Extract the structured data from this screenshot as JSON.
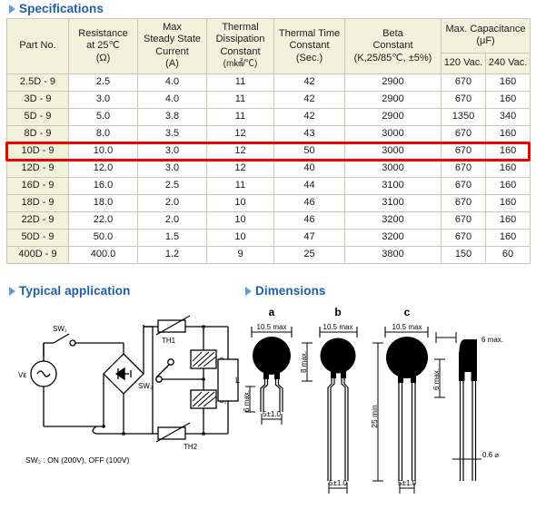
{
  "sections": {
    "specifications": {
      "title": "Specifications"
    },
    "typical_application": {
      "title": "Typical application"
    },
    "dimensions": {
      "title": "Dimensions"
    }
  },
  "spec_table": {
    "headers": {
      "part_no": "Part No.",
      "resistance": {
        "l1": "Resistance",
        "l2": "at 25℃",
        "l3": "(Ω)"
      },
      "max_current": {
        "l1": "Max",
        "l2": "Steady State",
        "l3": "Current",
        "l4": "(A)"
      },
      "dissipation": {
        "l1": "Thermal",
        "l2": "Dissipation",
        "l3": "Constant",
        "l4": "(m㎢/℃)"
      },
      "time_constant": {
        "l1": "Thermal Time",
        "l2": "Constant",
        "l3": "(Sec.)"
      },
      "beta": {
        "l1": "Beta",
        "l2": "Constant",
        "l3": "(K,25/85℃, ±5%)"
      },
      "capacitance": {
        "l1": "Max. Capacitance",
        "l2": "(μF)",
        "c120": "120 Vac.",
        "c240": "240 Vac."
      }
    },
    "rows": [
      {
        "part": "2.5D - 9",
        "res": "2.5",
        "cur": "4.0",
        "diss": "11",
        "ttc": "42",
        "beta": "2900",
        "c120": "670",
        "c240": "160"
      },
      {
        "part": "3D - 9",
        "res": "3.0",
        "cur": "4.0",
        "diss": "11",
        "ttc": "42",
        "beta": "2900",
        "c120": "670",
        "c240": "160"
      },
      {
        "part": "5D - 9",
        "res": "5.0",
        "cur": "3.8",
        "diss": "11",
        "ttc": "42",
        "beta": "2900",
        "c120": "1350",
        "c240": "340"
      },
      {
        "part": "8D - 9",
        "res": "8.0",
        "cur": "3.5",
        "diss": "12",
        "ttc": "43",
        "beta": "3000",
        "c120": "670",
        "c240": "160"
      },
      {
        "part": "10D - 9",
        "res": "10.0",
        "cur": "3.0",
        "diss": "12",
        "ttc": "50",
        "beta": "3000",
        "c120": "670",
        "c240": "160"
      },
      {
        "part": "12D - 9",
        "res": "12.0",
        "cur": "3.0",
        "diss": "12",
        "ttc": "40",
        "beta": "3000",
        "c120": "670",
        "c240": "160"
      },
      {
        "part": "16D - 9",
        "res": "16.0",
        "cur": "2.5",
        "diss": "11",
        "ttc": "44",
        "beta": "3100",
        "c120": "670",
        "c240": "160"
      },
      {
        "part": "18D - 9",
        "res": "18.0",
        "cur": "2.0",
        "diss": "10",
        "ttc": "46",
        "beta": "3100",
        "c120": "670",
        "c240": "160"
      },
      {
        "part": "22D - 9",
        "res": "22.0",
        "cur": "2.0",
        "diss": "10",
        "ttc": "46",
        "beta": "3200",
        "c120": "670",
        "c240": "160"
      },
      {
        "part": "50D - 9",
        "res": "50.0",
        "cur": "1.5",
        "diss": "10",
        "ttc": "47",
        "beta": "3200",
        "c120": "670",
        "c240": "160"
      },
      {
        "part": "400D - 9",
        "res": "400.0",
        "cur": "1.2",
        "diss": "9",
        "ttc": "25",
        "beta": "3800",
        "c120": "150",
        "c240": "60"
      }
    ],
    "highlighted_row_part": "10D - 9",
    "highlight_color": "#ee0000"
  },
  "circuit": {
    "labels": {
      "source": "Vᴇ",
      "sw1": "SW₁",
      "sw2": "SW₂",
      "th1": "TH1",
      "th2": "TH2",
      "c1": "C₁",
      "c2": "C₂",
      "load": "L"
    },
    "note": "SW₂ : ON (200V), OFF (100V)"
  },
  "dimensions_fig": {
    "variants": [
      "a",
      "b",
      "c"
    ],
    "body_width": "10.5 max",
    "lead_pitch": "5±1.0",
    "a_lead_len": "6 max.",
    "a_body_h": "8 max.",
    "b_lead_len": "",
    "c_lead_len": "25 min",
    "side_height": "6 max.",
    "side_width": "6 max.",
    "lead_dia": "0.6 ⌀"
  }
}
